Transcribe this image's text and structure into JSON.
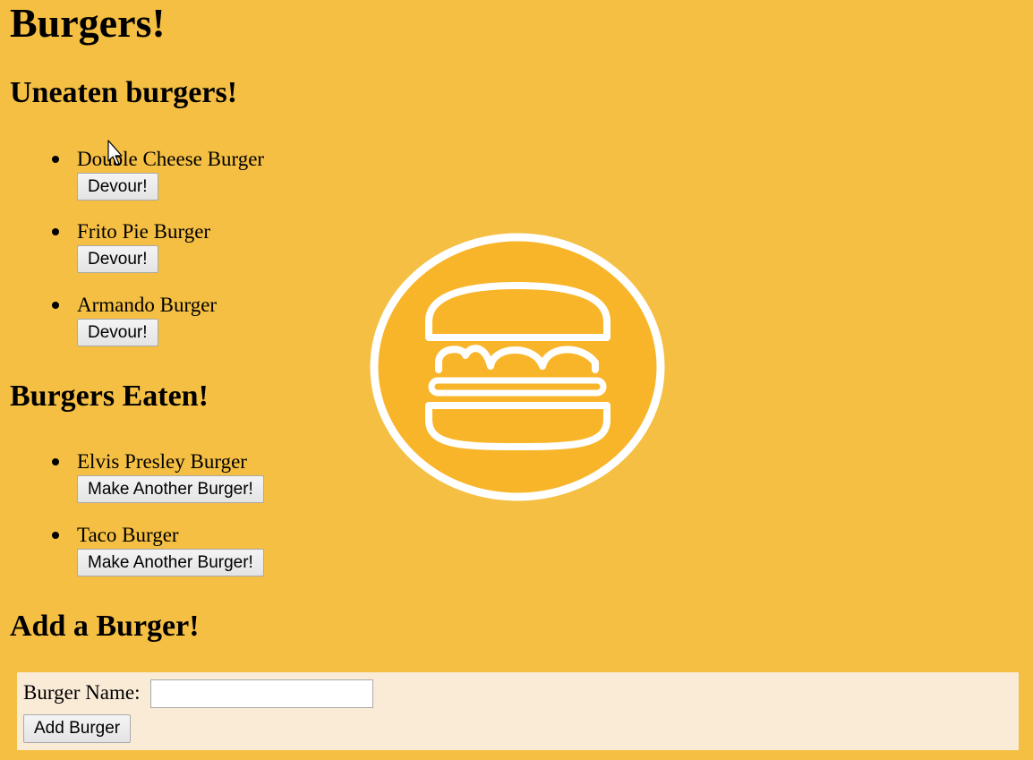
{
  "page": {
    "title": "Burgers!",
    "background_color": "#F5BF44"
  },
  "uneaten": {
    "heading": "Uneaten burgers!",
    "items": [
      {
        "name": "Double Cheese Burger",
        "button": "Devour!"
      },
      {
        "name": "Frito Pie Burger",
        "button": "Devour!"
      },
      {
        "name": "Armando Burger",
        "button": "Devour!"
      }
    ]
  },
  "eaten": {
    "heading": "Burgers Eaten!",
    "items": [
      {
        "name": "Elvis Presley Burger",
        "button": "Make Another Burger!"
      },
      {
        "name": "Taco Burger",
        "button": "Make Another Burger!"
      }
    ]
  },
  "add": {
    "heading": "Add a Burger!",
    "label": "Burger Name:",
    "input_value": "",
    "button": "Add Burger",
    "box_color": "#FAEBD7"
  },
  "logo": {
    "icon": "burger-logo-icon",
    "fill_color": "#F9B52A",
    "stroke_color": "#FFFFFF"
  }
}
